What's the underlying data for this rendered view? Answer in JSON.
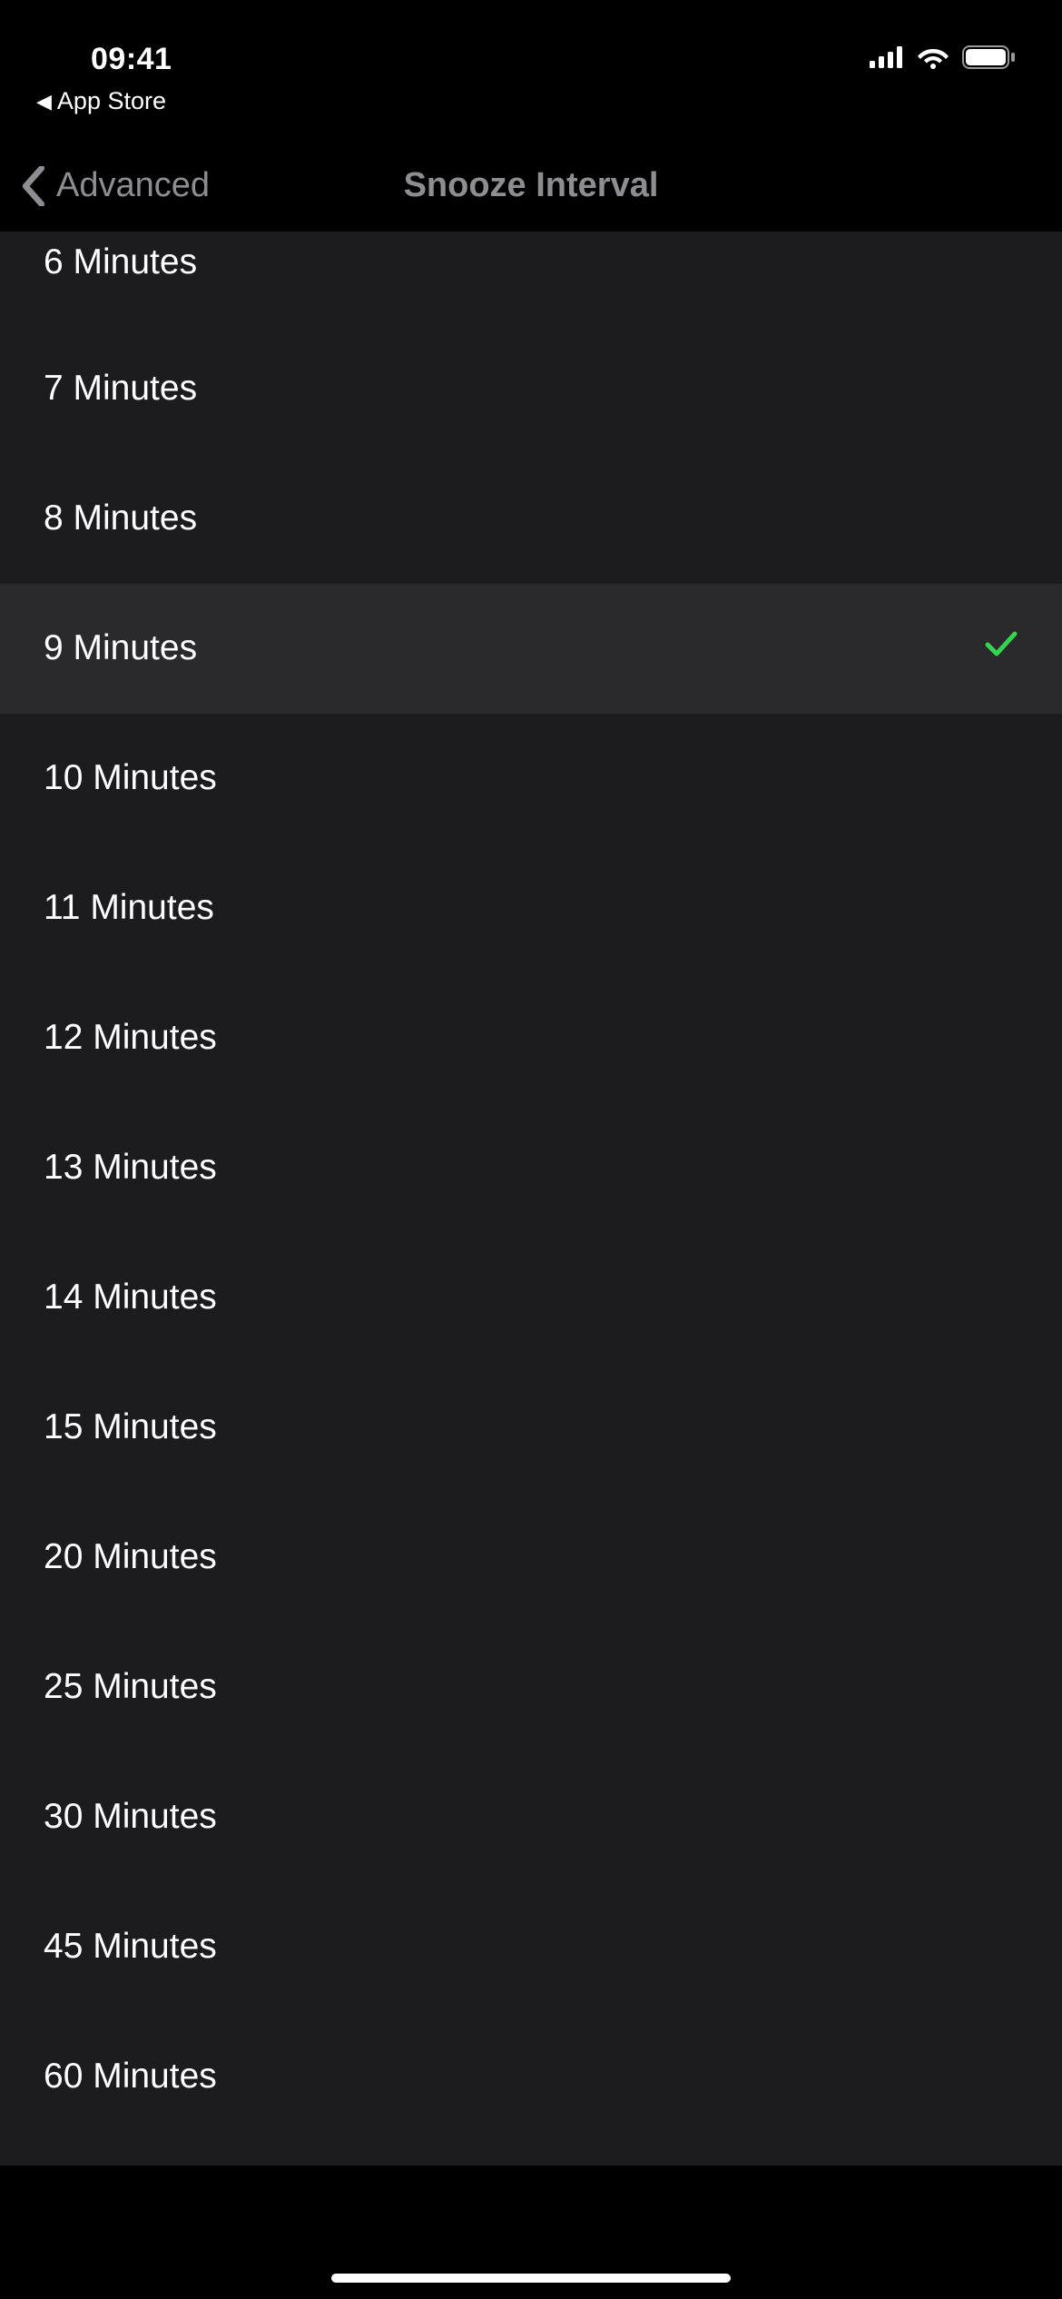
{
  "status": {
    "time": "09:41",
    "breadcrumb": "App Store"
  },
  "nav": {
    "back_label": "Advanced",
    "title": "Snooze Interval"
  },
  "options": [
    {
      "label": "6 Minutes",
      "selected": false
    },
    {
      "label": "7 Minutes",
      "selected": false
    },
    {
      "label": "8 Minutes",
      "selected": false
    },
    {
      "label": "9 Minutes",
      "selected": true
    },
    {
      "label": "10 Minutes",
      "selected": false
    },
    {
      "label": "11 Minutes",
      "selected": false
    },
    {
      "label": "12 Minutes",
      "selected": false
    },
    {
      "label": "13 Minutes",
      "selected": false
    },
    {
      "label": "14 Minutes",
      "selected": false
    },
    {
      "label": "15 Minutes",
      "selected": false
    },
    {
      "label": "20 Minutes",
      "selected": false
    },
    {
      "label": "25 Minutes",
      "selected": false
    },
    {
      "label": "30 Minutes",
      "selected": false
    },
    {
      "label": "45 Minutes",
      "selected": false
    },
    {
      "label": "60 Minutes",
      "selected": false
    }
  ],
  "colors": {
    "accent_green": "#32D74B",
    "row_bg": "#1C1C1E",
    "selected_row_bg": "#2A2A2C",
    "nav_text": "#8D8D92"
  }
}
